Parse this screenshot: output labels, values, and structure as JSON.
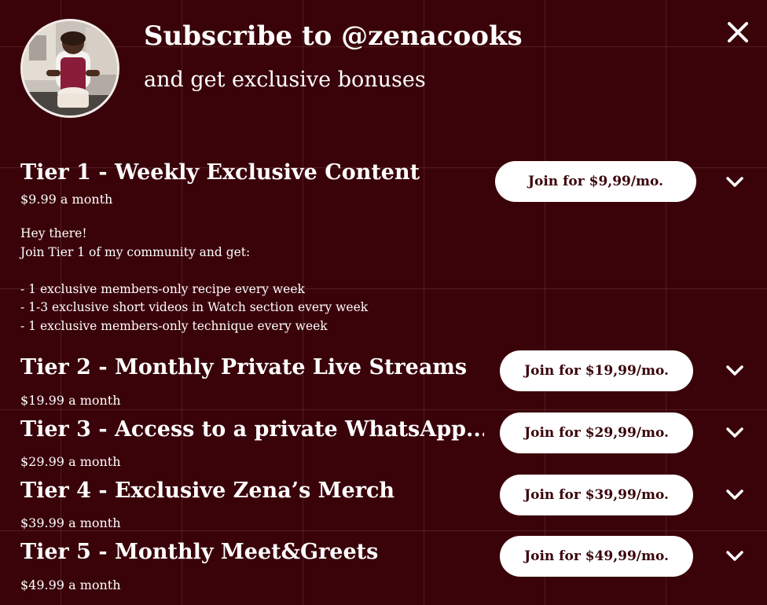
{
  "header": {
    "title": "Subscribe to @zenacooks",
    "subtitle": "and get exclusive bonuses",
    "close_icon": "close-icon",
    "avatar_icon": "chef-avatar"
  },
  "tiers": [
    {
      "name": "Tier 1 - Weekly Exclusive Content",
      "price": "$9.99 a month",
      "button": "Join for $9,99/mo.",
      "expanded": true,
      "description": [
        "Hey there!",
        "Join Tier 1 of my community and get:",
        "",
        "- 1 exclusive members-only recipe every week",
        "- 1-3 exclusive short videos in Watch section every week",
        "- 1 exclusive members-only technique every week"
      ]
    },
    {
      "name": "Tier 2 - Monthly Private Live Streams",
      "price": "$19.99 a month",
      "button": "Join for $19,99/mo.",
      "expanded": false
    },
    {
      "name": "Tier 3 - Access to a private WhatsApp...",
      "price": "$29.99 a month",
      "button": "Join for $29,99/mo.",
      "expanded": false
    },
    {
      "name": "Tier 4 - Exclusive Zena’s Merch",
      "price": "$39.99 a month",
      "button": "Join for $39,99/mo.",
      "expanded": false
    },
    {
      "name": "Tier 5 - Monthly Meet&Greets",
      "price": "$49.99 a month",
      "button": "Join for $49,99/mo.",
      "expanded": false
    }
  ],
  "colors": {
    "background": "#3a0309",
    "text": "#ffffff",
    "button_bg": "#ffffff",
    "button_text": "#3a0309"
  }
}
